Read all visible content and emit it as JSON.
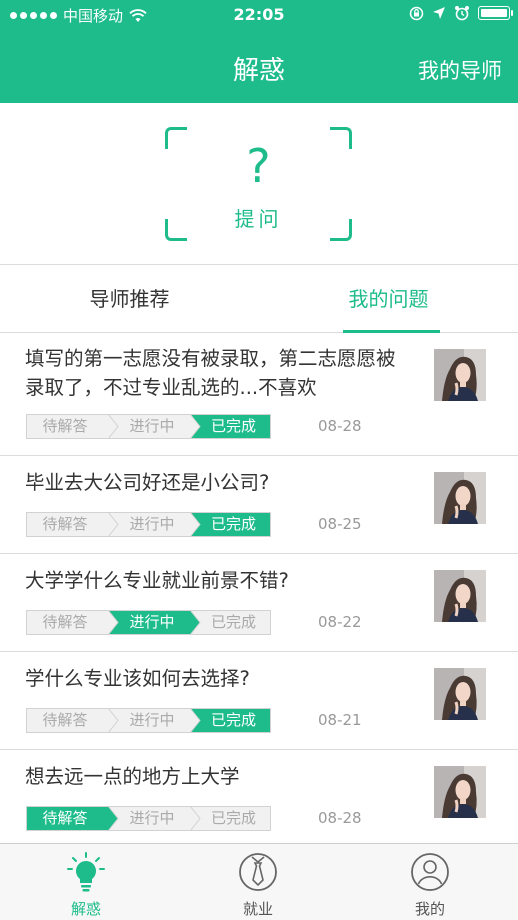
{
  "status_bar": {
    "carrier": "中国移动",
    "time": "22:05"
  },
  "header": {
    "title": "解惑",
    "right_action": "我的导师"
  },
  "ask": {
    "symbol": "?",
    "label": "提问"
  },
  "tabs": [
    {
      "label": "导师推荐",
      "active": false
    },
    {
      "label": "我的问题",
      "active": true
    }
  ],
  "progress_steps": [
    "待解答",
    "进行中",
    "已完成"
  ],
  "questions": [
    {
      "title": "填写的第一志愿没有被录取，第二志愿愿被录取了，不过专业乱选的...不喜欢",
      "date": "08-28",
      "status_index": 2
    },
    {
      "title": "毕业去大公司好还是小公司?",
      "date": "08-25",
      "status_index": 2
    },
    {
      "title": "大学学什么专业就业前景不错?",
      "date": "08-22",
      "status_index": 1
    },
    {
      "title": "学什么专业该如何去选择?",
      "date": "08-21",
      "status_index": 2
    },
    {
      "title": "想去远一点的地方上大学",
      "date": "08-28",
      "status_index": 0
    }
  ],
  "tabbar": [
    {
      "label": "解惑",
      "icon": "lightbulb-icon",
      "active": true
    },
    {
      "label": "就业",
      "icon": "tie-icon",
      "active": false
    },
    {
      "label": "我的",
      "icon": "user-icon",
      "active": false
    }
  ],
  "colors": {
    "accent": "#1dbc8a",
    "inactive_step": "#f1f1f1",
    "divider": "#dcdcdc"
  }
}
